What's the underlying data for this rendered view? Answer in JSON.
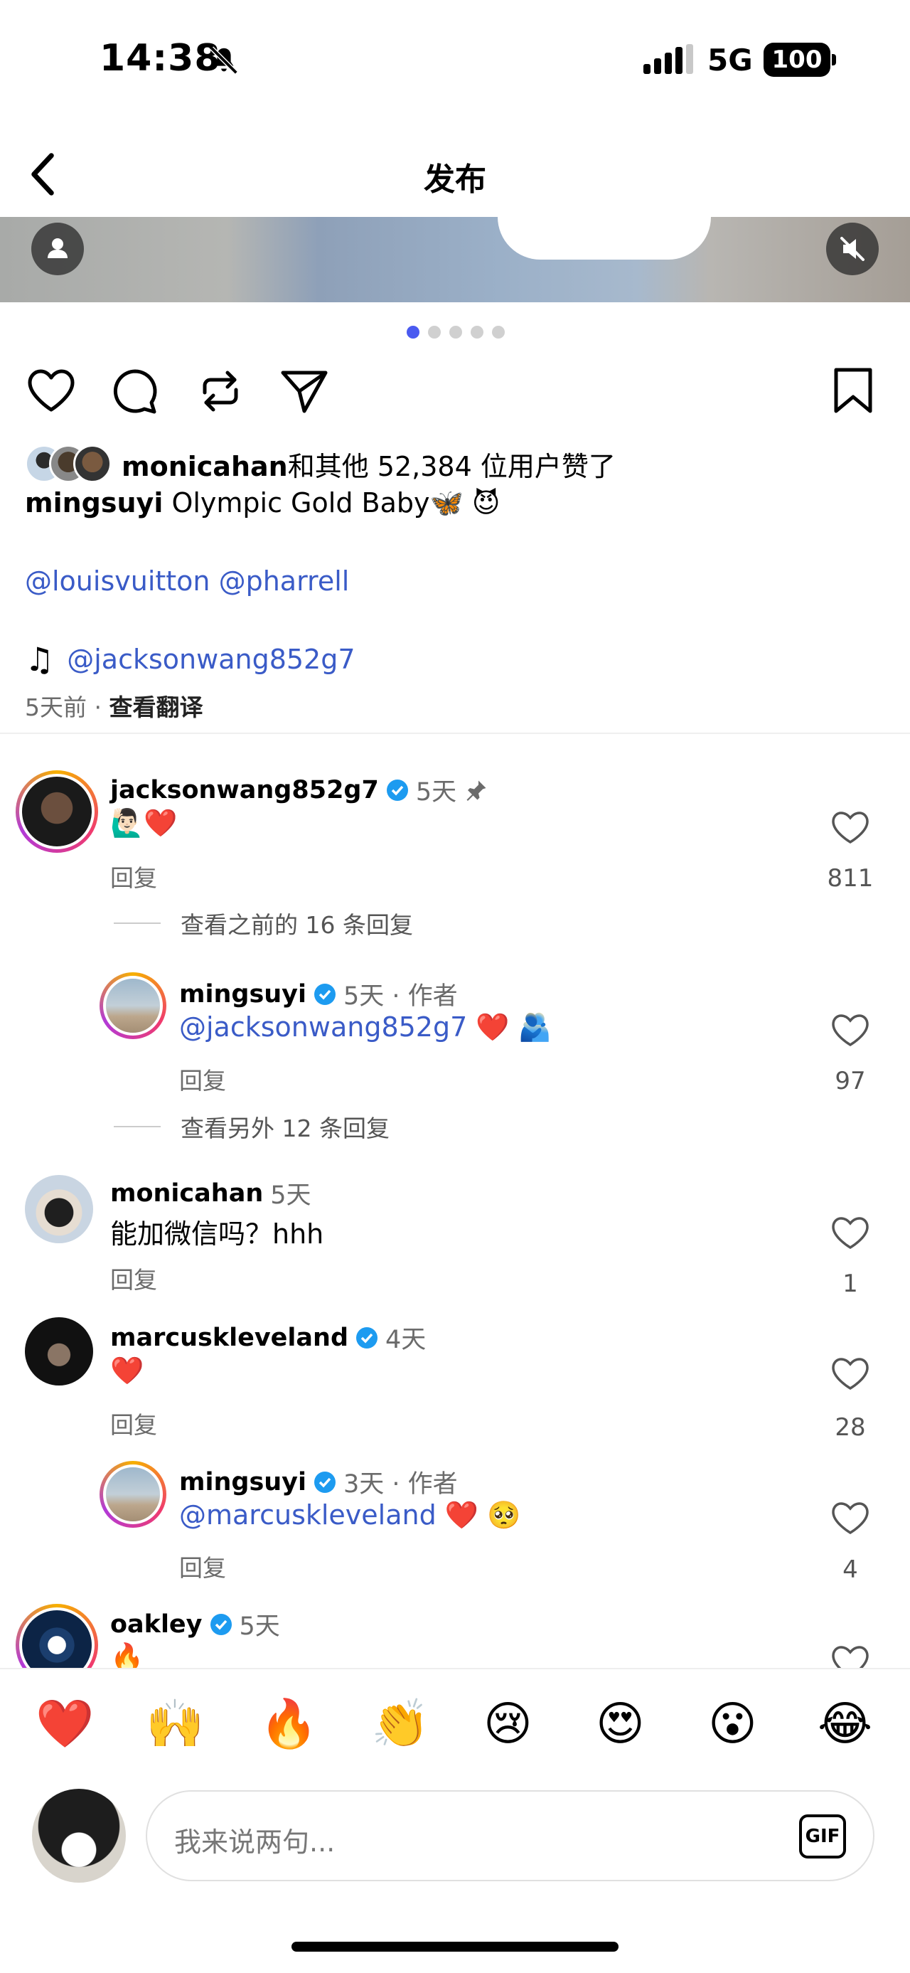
{
  "status_bar": {
    "time": "14:38",
    "network": "5G",
    "battery": "100"
  },
  "header": {
    "title": "发布"
  },
  "post": {
    "likes": {
      "user": "monicahan",
      "text": "和其他 52,384 位用户赞了"
    },
    "caption": {
      "user": "mingsuyi",
      "text": "Olympic Gold Baby🦋 😈"
    },
    "mentions": "@louisvuitton @pharrell",
    "music_mention": "@jacksonwang852g7",
    "time_ago": "5天前",
    "translate": "查看翻译"
  },
  "comments": [
    {
      "user": "jacksonwang852g7",
      "verified": true,
      "ago": "5天",
      "text": "🙋🏻‍♂️❤️",
      "reply_label": "回复",
      "likes": "811"
    },
    {
      "user": "mingsuyi",
      "verified": true,
      "ago": "5天 · 作者",
      "mention": "@jacksonwang852g7",
      "text": " ❤️ 🫂",
      "reply_label": "回复",
      "likes": "97"
    },
    {
      "user": "monicahan",
      "verified": false,
      "ago": "5天",
      "text": "能加微信吗？hhh",
      "reply_label": "回复",
      "likes": "1"
    },
    {
      "user": "marcuskleveland",
      "verified": true,
      "ago": "4天",
      "text": "❤️",
      "reply_label": "回复",
      "likes": "28"
    },
    {
      "user": "mingsuyi",
      "verified": true,
      "ago": "3天 · 作者",
      "mention": "@marcuskleveland",
      "text": " ❤️ 🥺",
      "reply_label": "回复",
      "likes": "4"
    },
    {
      "user": "oakley",
      "verified": true,
      "ago": "5天",
      "text": "🔥"
    }
  ],
  "more_replies": [
    "查看之前的 16 条回复",
    "查看另外 12 条回复"
  ],
  "reactions": [
    "❤️",
    "🙌",
    "🔥",
    "👏",
    "😢",
    "😍",
    "😮",
    "😂"
  ],
  "composer": {
    "placeholder": "我来说两句...",
    "gif_label": "GIF"
  },
  "colors": {
    "accent": "#4a5af0",
    "link": "#3a5bc7",
    "verified": "#1d9bf0",
    "heart": "#e0245e"
  }
}
